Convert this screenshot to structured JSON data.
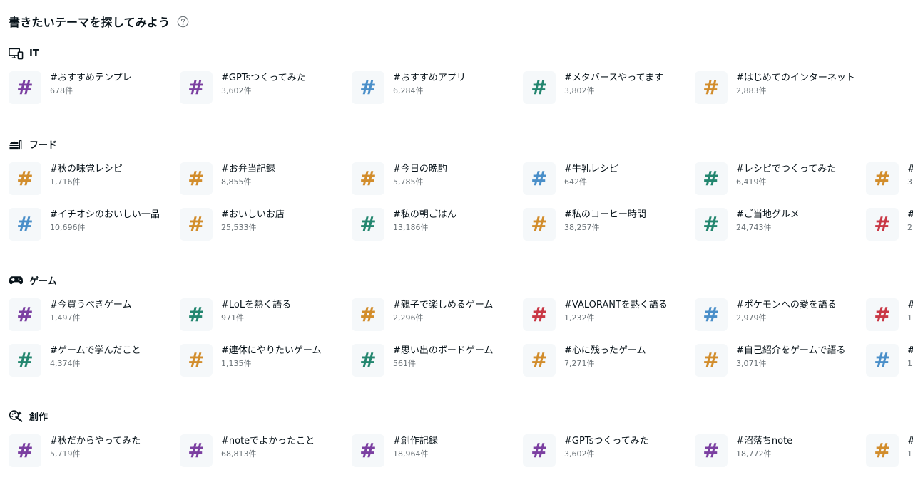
{
  "header": {
    "title": "書きたいテーマを探してみよう",
    "help_icon": "question-circle-icon"
  },
  "colors": {
    "purple": "#7b3fa1",
    "blue": "#4a8fc9",
    "green": "#23866f",
    "orange": "#d28d2c",
    "red": "#c93845",
    "tile_bg": "#f5f8fa"
  },
  "sections": [
    {
      "key": "it",
      "title": "IT",
      "icon": "devices-icon",
      "rows": [
        [
          {
            "name": "#おすすめテンプレ",
            "count": "678件",
            "color": "purple"
          },
          {
            "name": "#GPTsつくってみた",
            "count": "3,602件",
            "color": "purple"
          },
          {
            "name": "#おすすめアプリ",
            "count": "6,284件",
            "color": "blue"
          },
          {
            "name": "#メタバースやってます",
            "count": "3,802件",
            "color": "green"
          },
          {
            "name": "#はじめてのインターネット",
            "count": "2,883件",
            "color": "orange"
          }
        ]
      ]
    },
    {
      "key": "food",
      "title": "フード",
      "icon": "food-icon",
      "rows": [
        [
          {
            "name": "#秋の味覚レシピ",
            "count": "1,716件",
            "color": "orange"
          },
          {
            "name": "#お弁当記録",
            "count": "8,855件",
            "color": "orange"
          },
          {
            "name": "#今日の晩酌",
            "count": "5,785件",
            "color": "orange"
          },
          {
            "name": "#牛乳レシピ",
            "count": "642件",
            "color": "blue"
          },
          {
            "name": "#レシピでつくってみた",
            "count": "6,419件",
            "color": "green"
          },
          {
            "name": "#",
            "count": "3",
            "color": "orange"
          }
        ],
        [
          {
            "name": "#イチオシのおいしい一品",
            "count": "10,696件",
            "color": "blue"
          },
          {
            "name": "#おいしいお店",
            "count": "25,533件",
            "color": "orange"
          },
          {
            "name": "#私の朝ごはん",
            "count": "13,186件",
            "color": "green"
          },
          {
            "name": "#私のコーヒー時間",
            "count": "38,257件",
            "color": "orange"
          },
          {
            "name": "#ご当地グルメ",
            "count": "24,743件",
            "color": "green"
          },
          {
            "name": "#",
            "count": "2",
            "color": "red"
          }
        ]
      ]
    },
    {
      "key": "game",
      "title": "ゲーム",
      "icon": "gamepad-icon",
      "rows": [
        [
          {
            "name": "#今買うべきゲーム",
            "count": "1,497件",
            "color": "purple"
          },
          {
            "name": "#LoLを熱く語る",
            "count": "971件",
            "color": "green"
          },
          {
            "name": "#親子で楽しめるゲーム",
            "count": "2,296件",
            "color": "orange"
          },
          {
            "name": "#VALORANTを熱く語る",
            "count": "1,232件",
            "color": "red"
          },
          {
            "name": "#ポケモンへの愛を語る",
            "count": "2,979件",
            "color": "blue"
          },
          {
            "name": "#",
            "count": "1",
            "color": "red"
          }
        ],
        [
          {
            "name": "#ゲームで学んだこと",
            "count": "4,374件",
            "color": "green"
          },
          {
            "name": "#連休にやりたいゲーム",
            "count": "1,135件",
            "color": "orange"
          },
          {
            "name": "#思い出のボードゲーム",
            "count": "561件",
            "color": "green"
          },
          {
            "name": "#心に残ったゲーム",
            "count": "7,271件",
            "color": "orange"
          },
          {
            "name": "#自己紹介をゲームで語る",
            "count": "3,071件",
            "color": "orange"
          },
          {
            "name": "#",
            "count": "1",
            "color": "blue"
          }
        ]
      ]
    },
    {
      "key": "creation",
      "title": "創作",
      "icon": "creation-icon",
      "rows": [
        [
          {
            "name": "#秋だからやってみた",
            "count": "5,719件",
            "color": "purple"
          },
          {
            "name": "#noteでよかったこと",
            "count": "68,813件",
            "color": "purple"
          },
          {
            "name": "#創作記録",
            "count": "18,964件",
            "color": "purple"
          },
          {
            "name": "#GPTsつくってみた",
            "count": "3,602件",
            "color": "purple"
          },
          {
            "name": "#沼落ちnote",
            "count": "18,772件",
            "color": "purple"
          },
          {
            "name": "#",
            "count": "1",
            "color": "orange"
          }
        ]
      ]
    }
  ]
}
